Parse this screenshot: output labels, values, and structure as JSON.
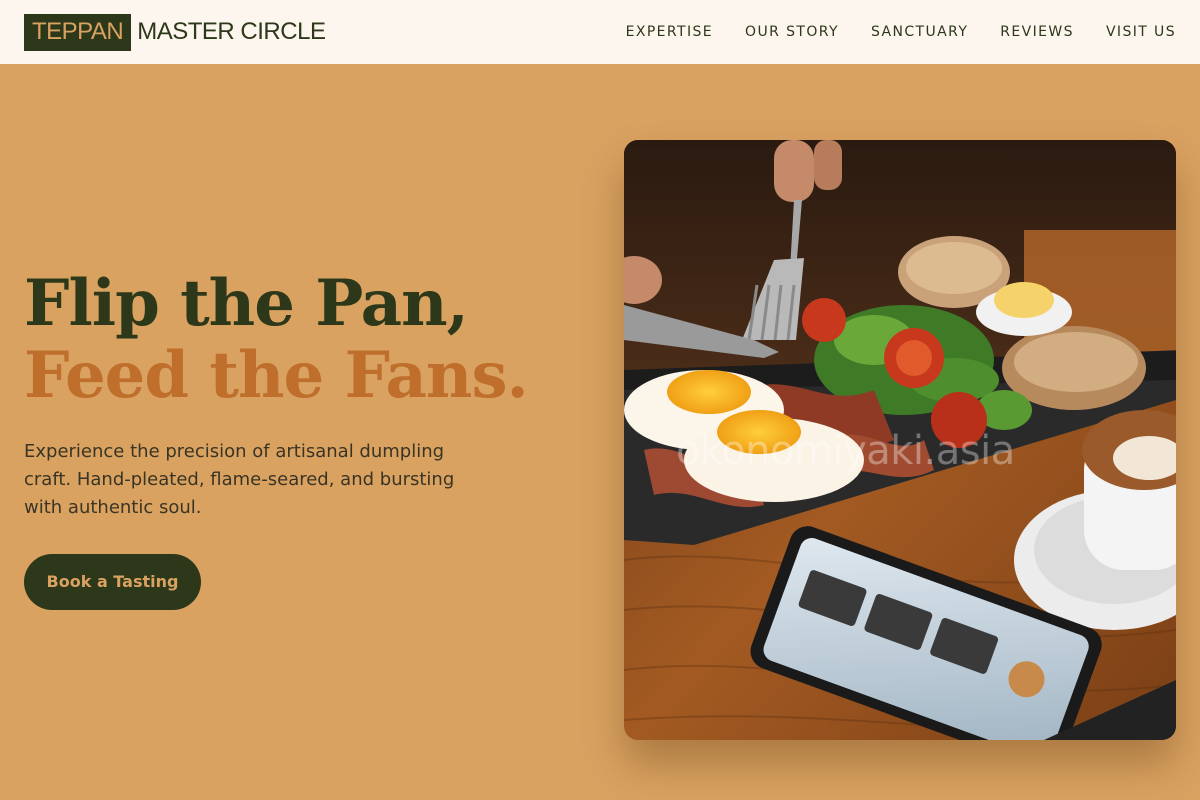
{
  "header": {
    "logo_highlight": "TEPPAN",
    "logo_rest": "MASTER CIRCLE",
    "nav": [
      {
        "label": "EXPERTISE"
      },
      {
        "label": "OUR STORY"
      },
      {
        "label": "SANCTUARY"
      },
      {
        "label": "REVIEWS"
      },
      {
        "label": "VISIT US"
      }
    ]
  },
  "hero": {
    "headline_line1": "Flip the Pan,",
    "headline_line2": "Feed the Fans.",
    "subtext": "Experience the precision of artisanal dumpling craft. Hand-pleated, flame-seared, and bursting with authentic soul.",
    "cta_label": "Book a Tasting",
    "image_watermark": "okonomiyaki.asia"
  },
  "colors": {
    "background": "#d9a261",
    "header_bg": "#fdf6ee",
    "dark_green": "#2c3819",
    "accent_orange": "#bf6e2c"
  }
}
